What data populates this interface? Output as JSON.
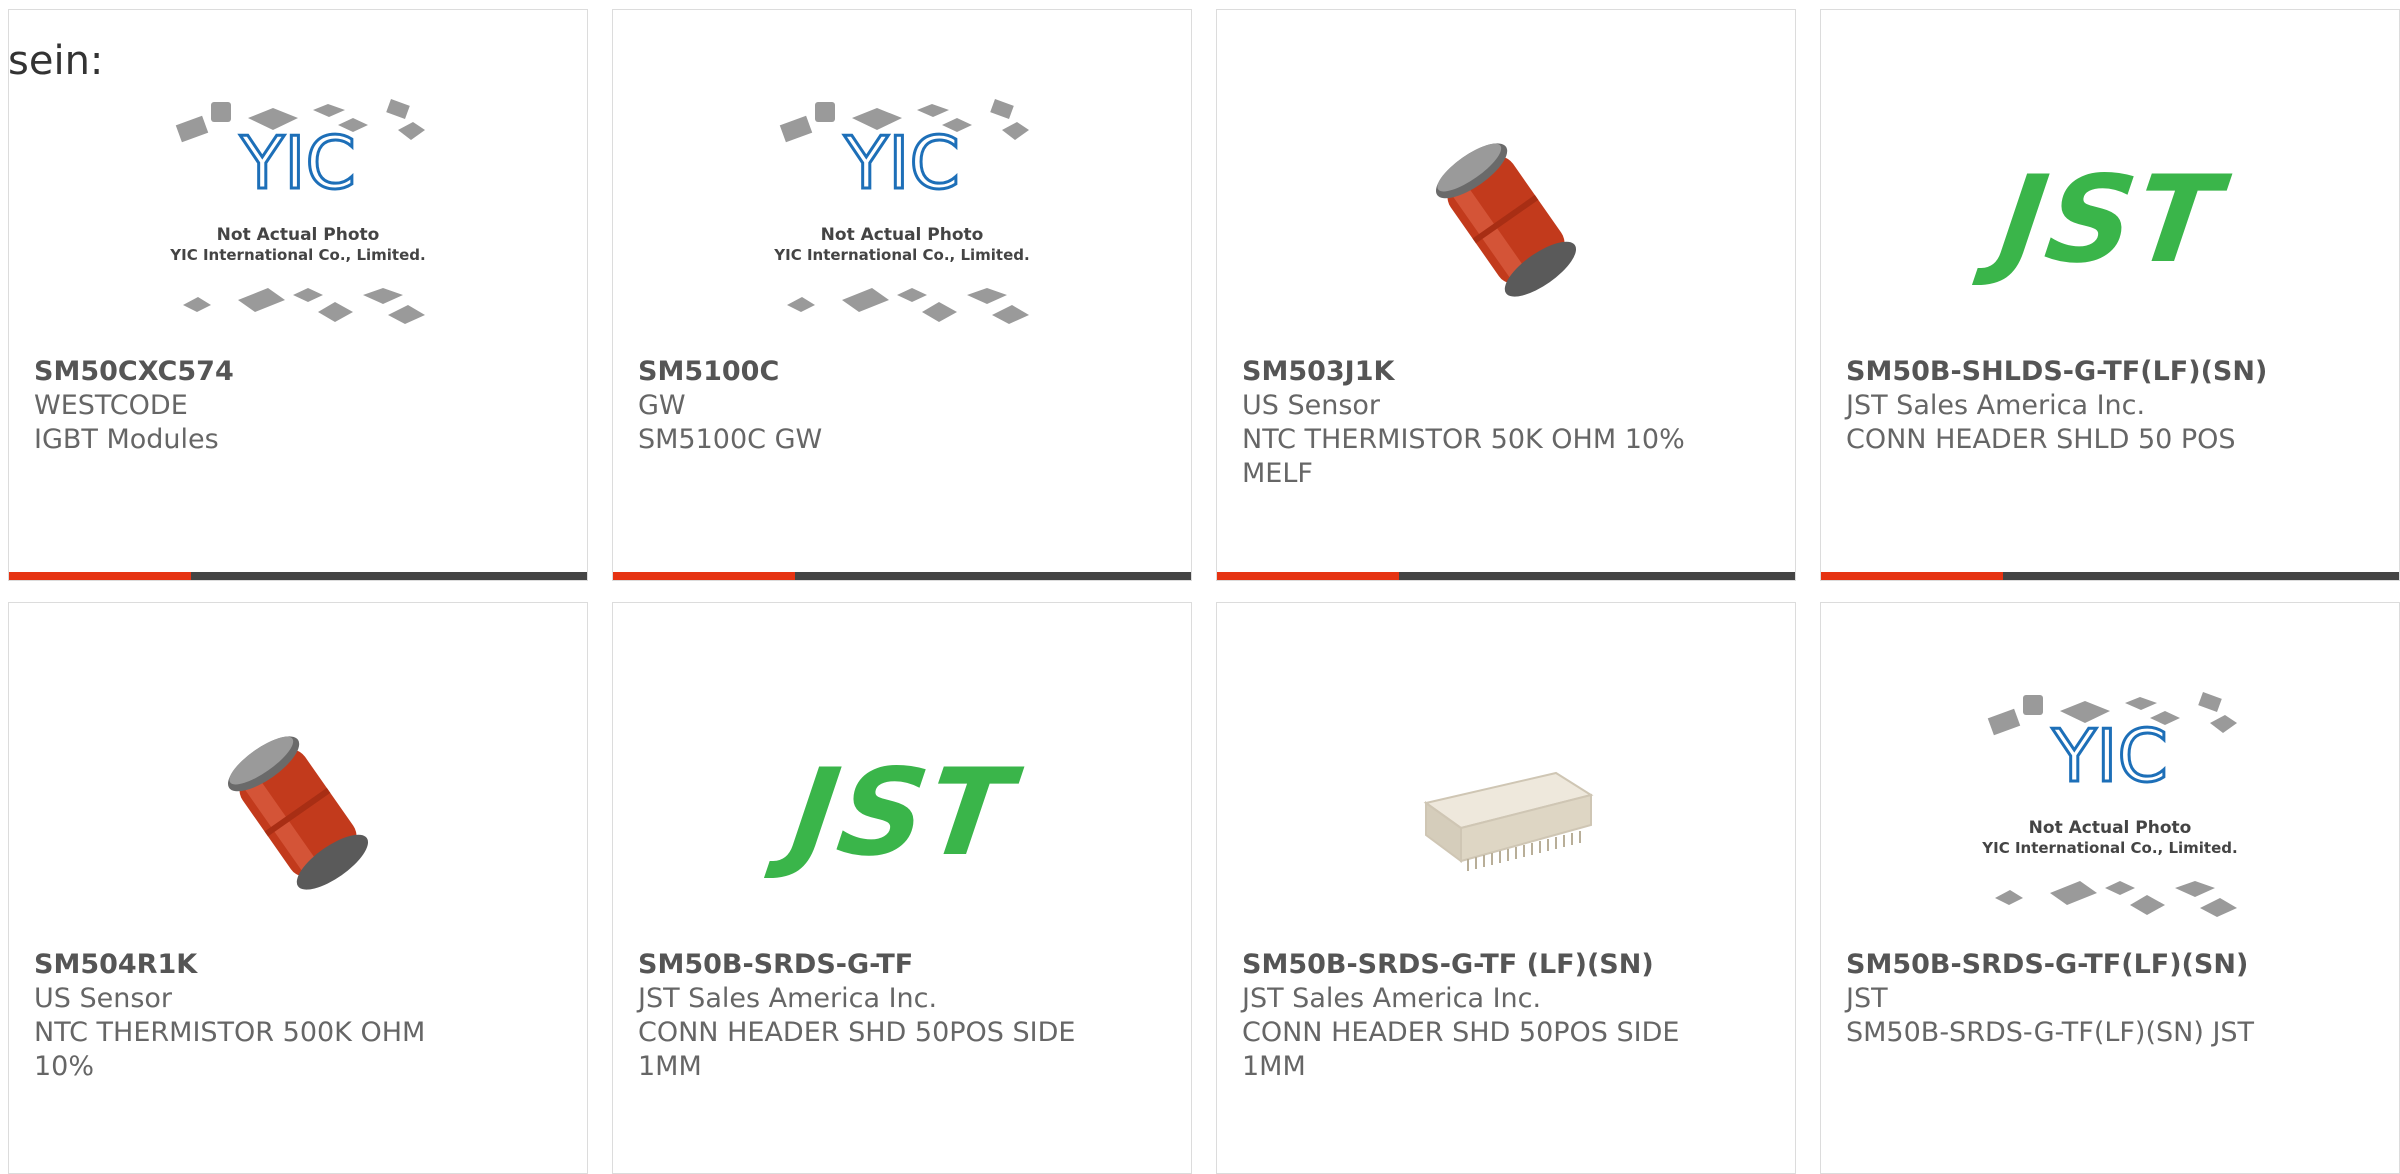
{
  "lead_text": "sein:",
  "products": [
    {
      "part": "SM50CXC574",
      "maker": "WESTCODE",
      "desc": "IGBT Modules",
      "image": "placeholder",
      "placeholder_line1": "Not Actual Photo",
      "placeholder_line2": "YIC International Co., Limited.",
      "logo_text": "YIC"
    },
    {
      "part": "SM5100C",
      "maker": "GW",
      "desc": "SM5100C GW",
      "image": "placeholder",
      "placeholder_line1": "Not Actual Photo",
      "placeholder_line2": "YIC International Co., Limited.",
      "logo_text": "YIC"
    },
    {
      "part": "SM503J1K",
      "maker": "US Sensor",
      "desc": "NTC THERMISTOR 50K OHM 10%",
      "desc2": "MELF",
      "image": "melf-thermistor"
    },
    {
      "part": "SM50B-SHLDS-G-TF(LF)(SN)",
      "maker": "JST Sales America Inc.",
      "desc": "CONN HEADER SHLD 50 POS",
      "image": "jst-logo",
      "logo_text": "JST"
    },
    {
      "part": "SM504R1K",
      "maker": "US Sensor",
      "desc": "NTC THERMISTOR 500K OHM",
      "desc2": "10%",
      "image": "melf-thermistor"
    },
    {
      "part": "SM50B-SRDS-G-TF",
      "maker": "JST Sales America Inc.",
      "desc": "CONN HEADER SHD 50POS SIDE",
      "desc2": "1MM",
      "image": "jst-logo",
      "logo_text": "JST"
    },
    {
      "part": "SM50B-SRDS-G-TF (LF)(SN)",
      "maker": "JST Sales America Inc.",
      "desc": "CONN HEADER SHD 50POS SIDE",
      "desc2": "1MM",
      "image": "connector-header"
    },
    {
      "part": "SM50B-SRDS-G-TF(LF)(SN)",
      "maker": "JST",
      "desc": "SM50B-SRDS-G-TF(LF)(SN) JST",
      "image": "placeholder",
      "placeholder_line1": "Not Actual Photo",
      "placeholder_line2": "YIC International Co., Limited.",
      "logo_text": "YIC"
    }
  ],
  "colors": {
    "accent": "#e63312",
    "bar": "#444444",
    "jst_green": "#3ab54a",
    "yic_blue": "#1d6fb8"
  }
}
